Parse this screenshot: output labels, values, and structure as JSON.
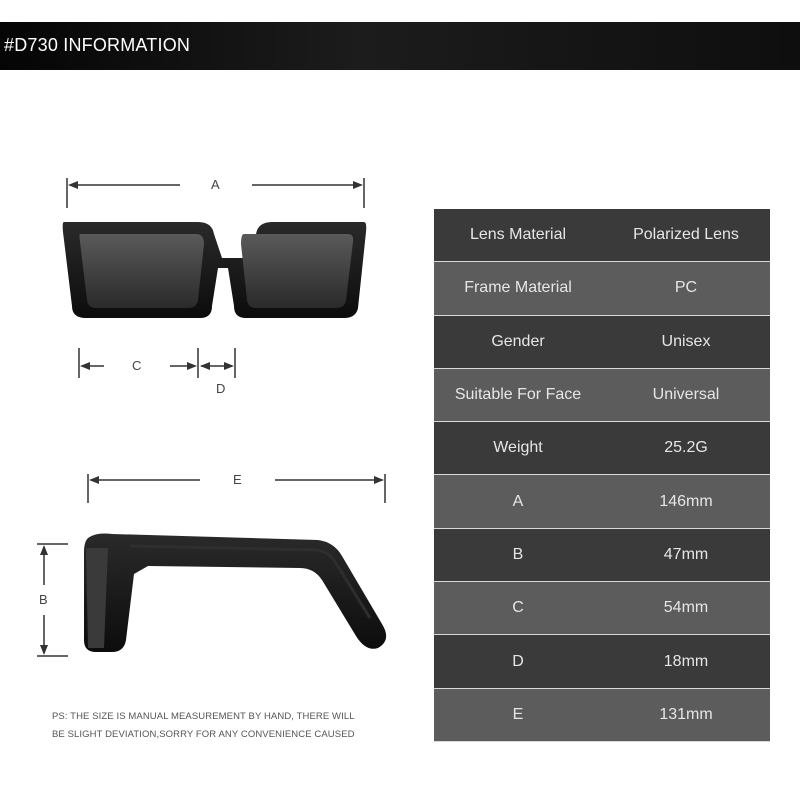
{
  "header": {
    "title": "#D730  INFORMATION"
  },
  "dimensions": {
    "a": "A",
    "b": "B",
    "c": "C",
    "d": "D",
    "e": "E"
  },
  "specs": [
    {
      "label": "Lens Material",
      "value": "Polarized Lens"
    },
    {
      "label": "Frame Material",
      "value": "PC"
    },
    {
      "label": "Gender",
      "value": "Unisex"
    },
    {
      "label": "Suitable For Face",
      "value": "Universal"
    },
    {
      "label": "Weight",
      "value": "25.2G"
    },
    {
      "label": "A",
      "value": "146mm"
    },
    {
      "label": "B",
      "value": "47mm"
    },
    {
      "label": "C",
      "value": "54mm"
    },
    {
      "label": "D",
      "value": "18mm"
    },
    {
      "label": "E",
      "value": "131mm"
    }
  ],
  "note": {
    "line1": "PS: THE SIZE IS MANUAL MEASUREMENT BY HAND, THERE WILL",
    "line2": "BE SLIGHT DEVIATION,SORRY FOR ANY CONVENIENCE CAUSED"
  }
}
